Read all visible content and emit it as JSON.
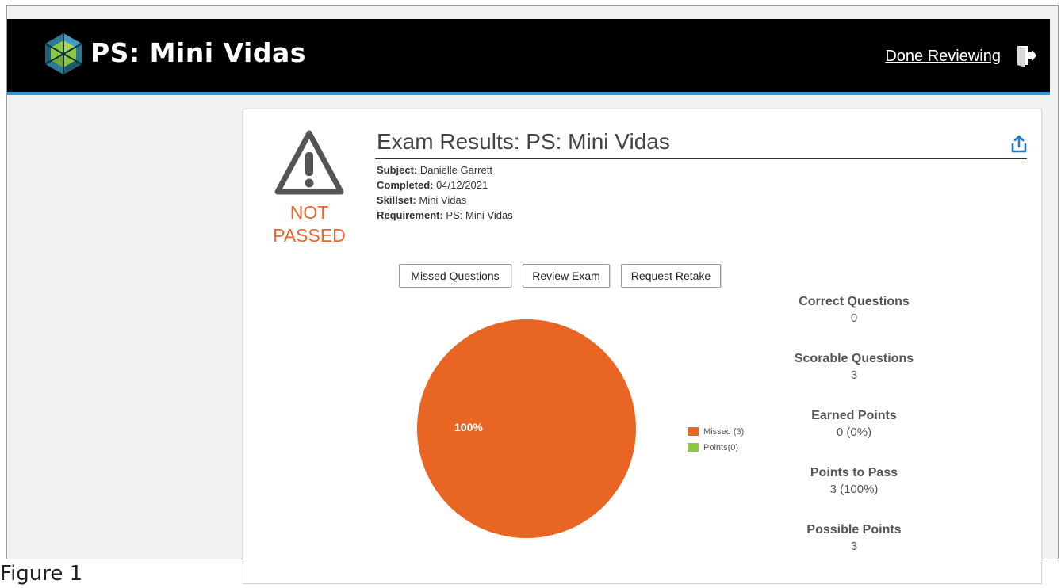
{
  "app": {
    "title": "PS: Mini Vidas",
    "done_label": "Done Reviewing"
  },
  "exam": {
    "status_line1": "NOT",
    "status_line2": "PASSED",
    "title": "Exam Results: PS: Mini Vidas",
    "meta": {
      "subject_label": "Subject:",
      "subject": "Danielle Garrett",
      "completed_label": "Completed:",
      "completed": "04/12/2021",
      "skillset_label": "Skillset:",
      "skillset": "Mini Vidas",
      "requirement_label": "Requirement:",
      "requirement": "PS: Mini Vidas"
    }
  },
  "buttons": {
    "missed": "Missed Questions",
    "review": "Review Exam",
    "retake": "Request Retake"
  },
  "chart_data": {
    "type": "pie",
    "slices": [
      {
        "name": "Missed (3)",
        "value": 3,
        "color": "#e86523"
      },
      {
        "name": "Points(0)",
        "value": 0,
        "color": "#8dc63f"
      }
    ],
    "data_label": "100%",
    "legend_position": "right"
  },
  "stats": [
    {
      "label": "Correct Questions",
      "value": "0"
    },
    {
      "label": "Scorable Questions",
      "value": "3"
    },
    {
      "label": "Earned Points",
      "value": "0 (0%)"
    },
    {
      "label": "Points to Pass",
      "value": "3 (100%)"
    },
    {
      "label": "Possible Points",
      "value": "3"
    }
  ],
  "caption": "Figure 1",
  "colors": {
    "header_bg": "#000000",
    "accent_blue": "#2b9bd7",
    "status_orange": "#e8662a",
    "missed": "#e86523",
    "points": "#8dc63f"
  }
}
